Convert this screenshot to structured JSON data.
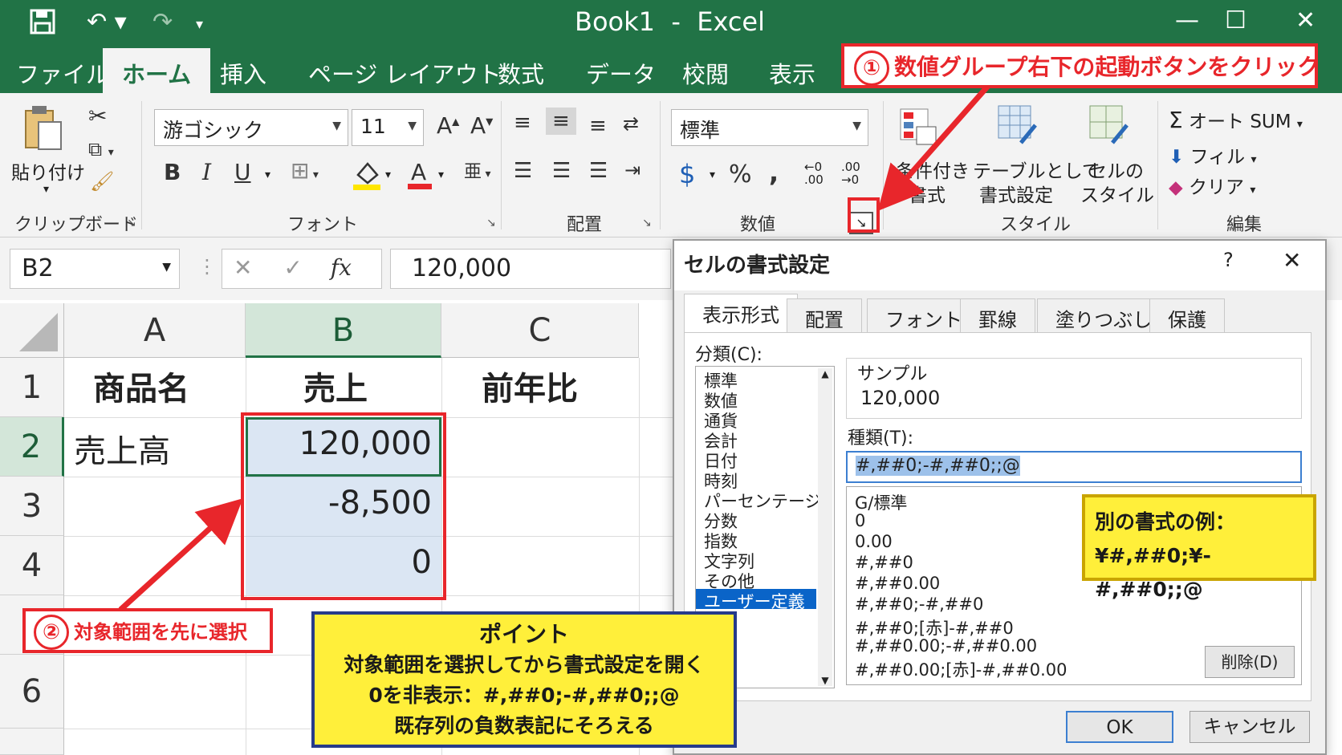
{
  "window": {
    "title": "Book1  -  Excel",
    "controls": {
      "minimize": "—",
      "maximize": "☐",
      "close": "✕"
    }
  },
  "ribbon_tabs": [
    "ファイル",
    "ホーム",
    "挿入",
    "ページ レイアウト",
    "数式",
    "データ",
    "校閲",
    "表示"
  ],
  "ribbon": {
    "clipboard": {
      "paste": "貼り付け",
      "label": "クリップボード"
    },
    "font": {
      "name": "游ゴシック",
      "size": "11",
      "bold": "B",
      "italic": "I",
      "underline": "U",
      "label": "フォント"
    },
    "alignment": {
      "label": "配置"
    },
    "number": {
      "format": "標準",
      "currency": "$",
      "percent": "%",
      "comma": ",",
      "label": "数値"
    },
    "styles": {
      "conditional": [
        "条件付き",
        "書式"
      ],
      "table": [
        "テーブルとして",
        "書式設定"
      ],
      "cell": [
        "セルの",
        "スタイル"
      ],
      "label": "スタイル"
    },
    "editing": {
      "autosum": "オート SUM",
      "fill": "フィル",
      "clear": "クリア",
      "label": "編集"
    }
  },
  "formula_bar": {
    "name_box": "B2",
    "fx": "fx",
    "value": "120,000"
  },
  "sheet": {
    "columns": [
      "A",
      "B",
      "C"
    ],
    "rows": [
      "1",
      "2",
      "3",
      "4",
      "6"
    ],
    "cells": {
      "A1": "商品名",
      "B1": "売上",
      "C1": "前年比",
      "A2": "売上高",
      "B2": "120,000",
      "B3": "-8,500",
      "B4": "0"
    }
  },
  "dialog": {
    "title": "セルの書式設定",
    "help": "?",
    "close": "✕",
    "tabs": [
      "表示形式",
      "配置",
      "フォント",
      "罫線",
      "塗りつぶし",
      "保護"
    ],
    "category_label": "分類(C):",
    "categories": [
      "標準",
      "数値",
      "通貨",
      "会計",
      "日付",
      "時刻",
      "パーセンテージ",
      "分数",
      "指数",
      "文字列",
      "その他",
      "ユーザー定義"
    ],
    "sample_label": "サンプル",
    "sample_value": "120,000",
    "type_label": "種類(T):",
    "type_value": "#,##0;-#,##0;;@",
    "formats": [
      "G/標準",
      "0",
      "0.00",
      "#,##0",
      "#,##0.00",
      "#,##0;-#,##0",
      "#,##0;[赤]-#,##0",
      "#,##0.00;-#,##0.00",
      "#,##0.00;[赤]-#,##0.00"
    ],
    "delete_button": "削除(D)",
    "ok_button": "OK",
    "cancel_button": "キャンセル"
  },
  "annotations": {
    "step1_num": "①",
    "step1": "数値グループ右下の起動ボタンをクリック",
    "step2_num": "②",
    "step2": "対象範囲を先に選択",
    "example": [
      "別の書式の例：",
      "¥#,##0;¥-#,##0;;@"
    ],
    "point": [
      "ポイント",
      "対象範囲を選択してから書式設定を開く",
      "0を非表示：#,##0;-#,##0;;@",
      "既存列の負数表記にそろえる"
    ],
    "colors": {
      "red": "#e8262b",
      "yellow": "#ffef3a",
      "excel_green": "#217346"
    }
  }
}
